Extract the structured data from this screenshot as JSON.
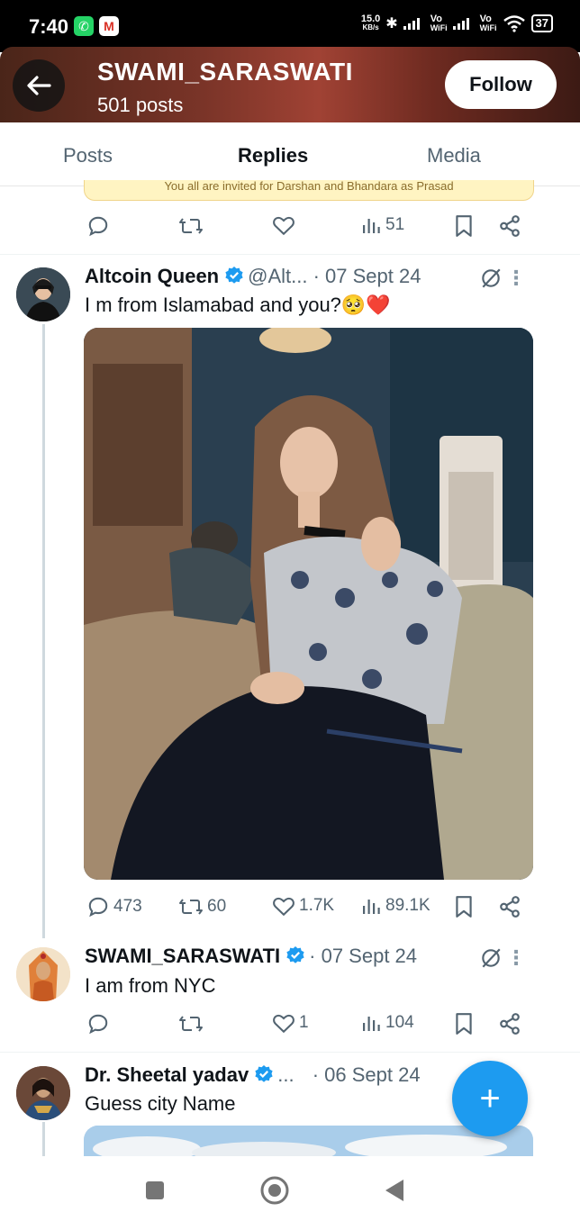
{
  "status_bar": {
    "time": "7:40",
    "net_speed_top": "15.0",
    "net_speed_bottom": "KB/s",
    "vo_top": "Vo",
    "wifi_label": "WiFi",
    "battery": "37",
    "icons": [
      "whatsapp-icon",
      "gmail-icon",
      "bluetooth-icon",
      "signal-icon",
      "wifi-icon",
      "battery-icon"
    ]
  },
  "header": {
    "title": "SWAMI_SARASWATI",
    "post_count": "501 posts",
    "follow_label": "Follow"
  },
  "tabs": [
    {
      "label": "Posts",
      "active": false
    },
    {
      "label": "Replies",
      "active": true
    },
    {
      "label": "Media",
      "active": false
    }
  ],
  "previous_post": {
    "snippet": "You all are invited for Darshan and Bhandara as Prasad",
    "actions": {
      "views": "51"
    }
  },
  "posts": [
    {
      "name": "Altcoin Queen",
      "handle": "@Alt...",
      "date": "· 07 Sept 24",
      "text": "I m from Islamabad and you?🥺❤️",
      "has_media": true,
      "actions": {
        "replies": "473",
        "reposts": "60",
        "likes": "1.7K",
        "views": "89.1K"
      }
    },
    {
      "name": "SWAMI_SARASWATI",
      "handle": "",
      "date": "· 07 Sept 24",
      "text": "I am from NYC",
      "has_media": false,
      "actions": {
        "replies": "",
        "reposts": "",
        "likes": "1",
        "views": "104"
      }
    },
    {
      "name": "Dr. Sheetal yadav",
      "handle": "...",
      "date": "· 06 Sept 24",
      "text": "Guess city Name",
      "has_media": true,
      "actions": {}
    }
  ],
  "fab_label": "+",
  "colors": {
    "accent": "#1d9bf0",
    "text_primary": "#0f1419",
    "text_secondary": "#536471",
    "like_red": "#e0245e"
  }
}
